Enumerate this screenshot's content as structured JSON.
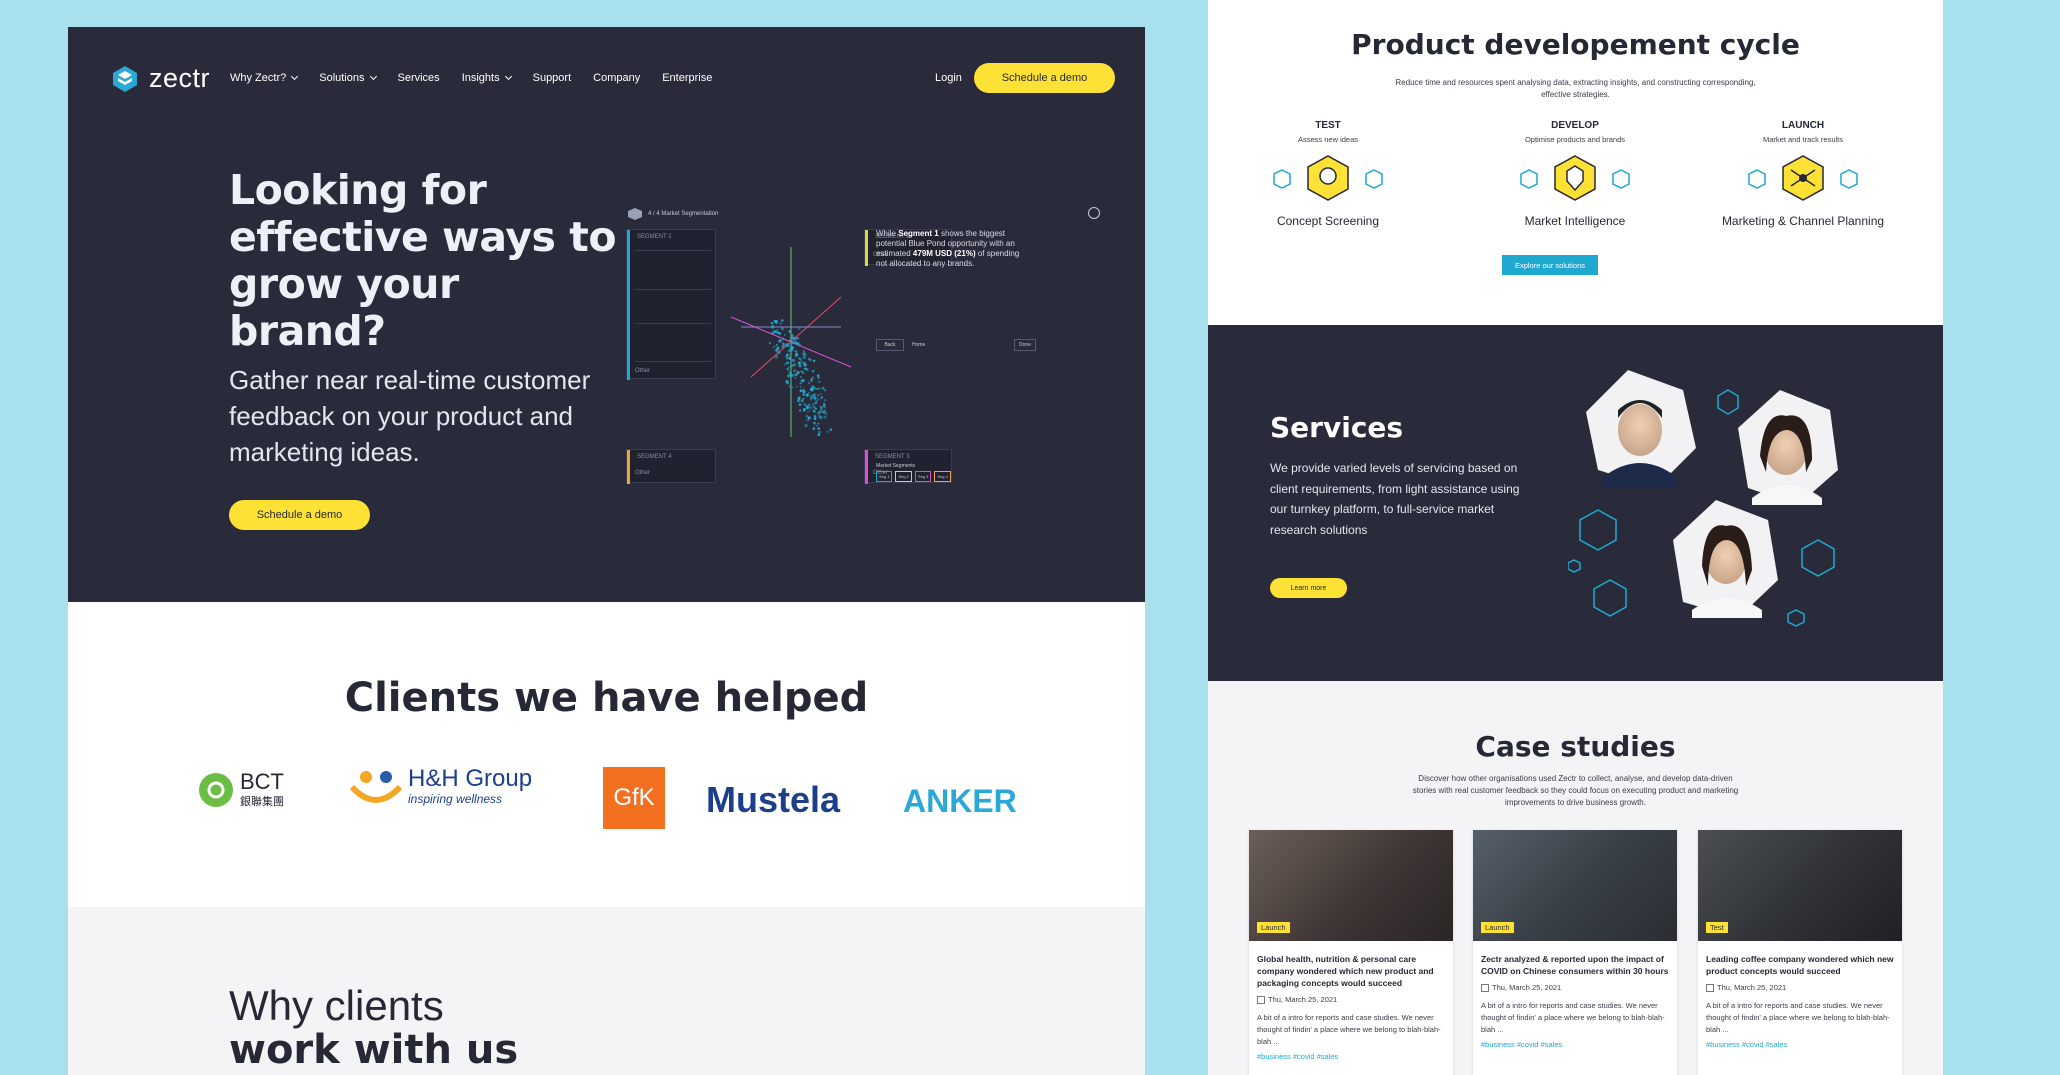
{
  "left": {
    "brand": "zectr",
    "nav": [
      {
        "label": "Why Zectr?",
        "dropdown": true
      },
      {
        "label": "Solutions",
        "dropdown": true
      },
      {
        "label": "Services",
        "dropdown": false
      },
      {
        "label": "Insights",
        "dropdown": true
      },
      {
        "label": "Support",
        "dropdown": false
      },
      {
        "label": "Company",
        "dropdown": false
      },
      {
        "label": "Enterprise",
        "dropdown": false
      }
    ],
    "login": "Login",
    "cta_top": "Schedule a demo",
    "hero_title": "Looking for effective ways to grow your brand?",
    "hero_sub": "Gather near real-time customer feedback on your product and marketing ideas.",
    "cta_hero": "Schedule a demo",
    "dashboard": {
      "breadcrumb": "4 / 4   Market Segmentation",
      "segment1": "SEGMENT 1",
      "segment2": "SEGMENT 2",
      "segment3": "SEGMENT 3",
      "segment4": "SEGMENT 4",
      "insight_pre": "While",
      "insight_seg": "Segment 1",
      "insight_mid": "shows the biggest potential Blue Pond opportunity with an estimated",
      "insight_val": "479M USD (21%)",
      "insight_post": "of spending not allocated to any brands.",
      "back": "Back",
      "home": "Home",
      "done": "Done",
      "legend_title": "Market Segments",
      "legend": [
        "Seg 1",
        "Seg 2",
        "Seg 3",
        "Seg 4"
      ],
      "other": "Other"
    },
    "clients_title": "Clients we have helped",
    "clients": {
      "bct": "BCT",
      "bct_cn": "銀聯集團",
      "hh": "H&H Group",
      "hh_tag": "inspiring wellness",
      "gfk": "GfK",
      "mustela": "Mustela",
      "anker": "ANKER"
    },
    "why_1": "Why clients",
    "why_2": "work with us"
  },
  "right": {
    "pd_title": "Product developement cycle",
    "pd_sub": "Reduce time and resources spent analysing data, extracting insights, and constructing corresponding, effective strategies.",
    "stages": [
      {
        "key": "TEST",
        "sub": "Assess new ideas",
        "name": "Concept Screening"
      },
      {
        "key": "DEVELOP",
        "sub": "Optimise products and brands",
        "name": "Market Intelligence"
      },
      {
        "key": "LAUNCH",
        "sub": "Market and track results",
        "name": "Marketing & Channel Planning"
      }
    ],
    "explore": "Explore our solutions",
    "services_title": "Services",
    "services_body": "We provide varied levels of servicing based on client requirements, from light assistance using our turnkey platform, to full-service market research solutions",
    "learn_more": "Learn more",
    "case_title": "Case studies",
    "case_sub": "Discover how other organisations used Zectr to collect, analyse, and develop data-driven stories with real customer feedback so they could focus on executing product and marketing improvements to drive business growth.",
    "cards": [
      {
        "badge": "Launch",
        "title": "Global health, nutrition & personal care company wondered which new product and packaging concepts would succeed",
        "date": "Thu, March 25, 2021",
        "text": "A bit of a intro for reports and case studies. We never thought of findin' a place where we belong to blah-blah-blah ...",
        "tags": "#business  #covid  #sales"
      },
      {
        "badge": "Launch",
        "title": "Zectr analyzed & reported upon the impact of COVID on Chinese consumers within 30 hours",
        "date": "Thu, March 25, 2021",
        "text": "A bit of a intro for reports and case studies. We never thought of findin' a place where we belong to blah-blah-blah ...",
        "tags": "#business  #covid  #sales"
      },
      {
        "badge": "Test",
        "title": "Leading coffee company wondered which new product concepts would succeed",
        "date": "Thu, March 25, 2021",
        "text": "A bit of a intro for reports and case studies. We never thought of findin' a place where we belong to blah-blah-blah ...",
        "tags": "#business  #covid  #sales"
      }
    ]
  },
  "colors": {
    "bg": "#a9e0ee",
    "dark": "#292b3a",
    "yellow": "#fde134",
    "accent": "#1fa9d1"
  }
}
